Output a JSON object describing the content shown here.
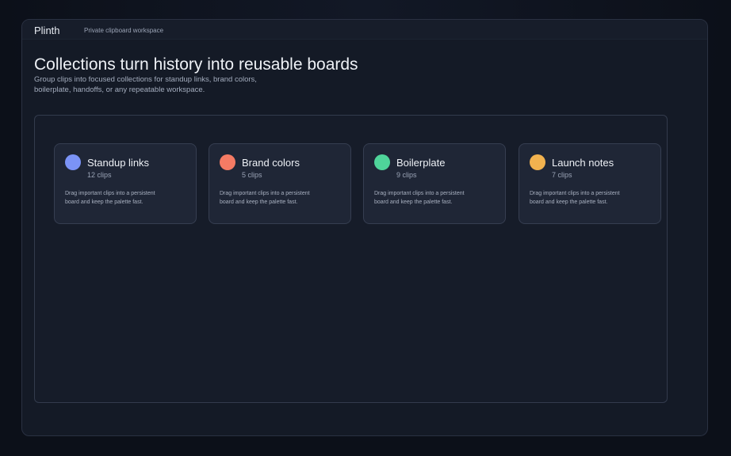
{
  "app": {
    "brand": "Plinth",
    "tagline": "Private clipboard workspace"
  },
  "main": {
    "headline": "Collections turn history into reusable boards",
    "subtitle": "Group clips into focused collections for standup links, brand colors, boilerplate, handoffs, or any repeatable workspace."
  },
  "collections": [
    {
      "name": "Standup links",
      "count": "12 clips",
      "description": "Drag important clips into a persistent board and keep the palette fast.",
      "color": "#7b93f6"
    },
    {
      "name": "Brand colors",
      "count": "5 clips",
      "description": "Drag important clips into a persistent board and keep the palette fast.",
      "color": "#f57b64"
    },
    {
      "name": "Boilerplate",
      "count": "9 clips",
      "description": "Drag important clips into a persistent board and keep the palette fast.",
      "color": "#4fd49a"
    },
    {
      "name": "Launch notes",
      "count": "7 clips",
      "description": "Drag important clips into a persistent board and keep the palette fast.",
      "color": "#f1b24f"
    }
  ]
}
